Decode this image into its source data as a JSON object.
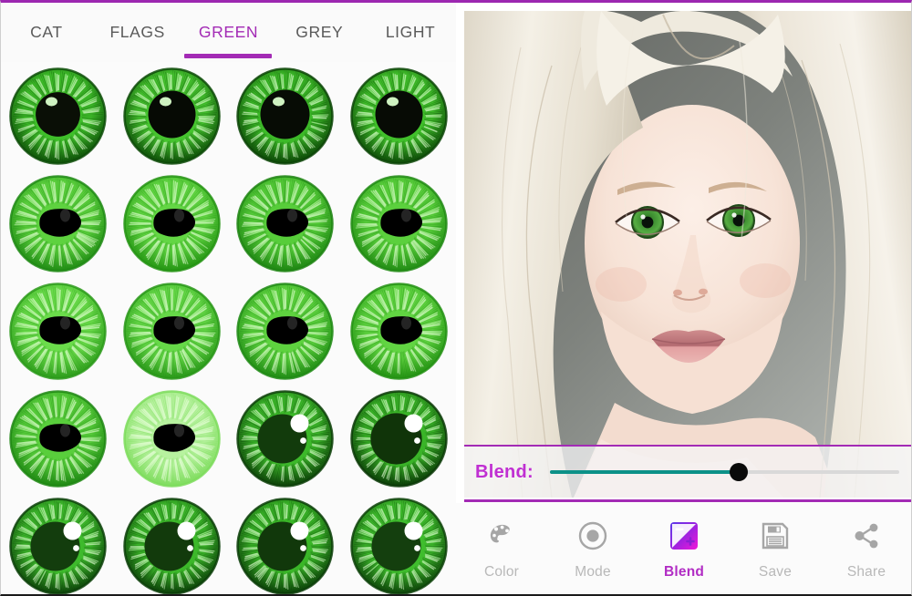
{
  "app": {
    "accent_purple": "#a32bb5",
    "accent_magenta": "#c02fd2",
    "slider_fill_color": "#0c9188",
    "panel_background": "#fafafa"
  },
  "tabs": {
    "active_index": 2,
    "items": [
      {
        "label": "CAT"
      },
      {
        "label": "FLAGS"
      },
      {
        "label": "GREEN"
      },
      {
        "label": "GREY"
      },
      {
        "label": "LIGHT"
      }
    ]
  },
  "thumbnail_grid": {
    "columns": 4,
    "rows_visible": 5,
    "category": "GREEN",
    "items": [
      {
        "name": "green-iris-radial-dark-1",
        "style": "radial-dark",
        "iris": "#3fbf2a",
        "iris_edge": "#0d4d08",
        "pupil": "#0a0f06",
        "pupil_ratio": 0.47,
        "highlight": "top-left-small"
      },
      {
        "name": "green-iris-radial-dark-2",
        "style": "radial-dark",
        "iris": "#46c42f",
        "iris_edge": "#0c4a07",
        "pupil": "#060a04",
        "pupil_ratio": 0.5,
        "highlight": "top-left-small"
      },
      {
        "name": "green-iris-radial-dark-3",
        "style": "radial-dark",
        "iris": "#3cb928",
        "iris_edge": "#0b4406",
        "pupil": "#070c05",
        "pupil_ratio": 0.52,
        "highlight": "top-left-small"
      },
      {
        "name": "green-iris-radial-dark-4",
        "style": "radial-dark",
        "iris": "#41c02b",
        "iris_edge": "#0c4707",
        "pupil": "#070b05",
        "pupil_ratio": 0.5,
        "highlight": "top-left-small"
      },
      {
        "name": "green-iris-cartoon-1",
        "style": "cartoon",
        "iris": "#5ed23f",
        "iris_edge": "#1f8a14",
        "pupil": "#000000",
        "pupil_ratio": 0.4,
        "highlight": "none"
      },
      {
        "name": "green-iris-cartoon-2",
        "style": "cartoon",
        "iris": "#63d644",
        "iris_edge": "#239312",
        "pupil": "#000000",
        "pupil_ratio": 0.38,
        "highlight": "none"
      },
      {
        "name": "green-iris-cartoon-3",
        "style": "cartoon",
        "iris": "#57cd3a",
        "iris_edge": "#1d8412",
        "pupil": "#000000",
        "pupil_ratio": 0.4,
        "highlight": "none"
      },
      {
        "name": "green-iris-cartoon-4",
        "style": "cartoon",
        "iris": "#5bd03d",
        "iris_edge": "#208a13",
        "pupil": "#000000",
        "pupil_ratio": 0.4,
        "highlight": "none"
      },
      {
        "name": "green-iris-cartoon-5",
        "style": "cartoon",
        "iris": "#6bdc4b",
        "iris_edge": "#2b9a1a",
        "pupil": "#000000",
        "pupil_ratio": 0.38,
        "highlight": "none"
      },
      {
        "name": "green-iris-cartoon-6",
        "style": "cartoon",
        "iris": "#66d848",
        "iris_edge": "#289618",
        "pupil": "#000000",
        "pupil_ratio": 0.38,
        "highlight": "none"
      },
      {
        "name": "green-iris-cartoon-7",
        "style": "cartoon",
        "iris": "#5ed23f",
        "iris_edge": "#1f8a14",
        "pupil": "#000000",
        "pupil_ratio": 0.4,
        "highlight": "none"
      },
      {
        "name": "green-iris-cartoon-8",
        "style": "cartoon",
        "iris": "#61d442",
        "iris_edge": "#229012",
        "pupil": "#000000",
        "pupil_ratio": 0.4,
        "highlight": "none"
      },
      {
        "name": "green-iris-cartoon-9",
        "style": "cartoon",
        "iris": "#59ce3c",
        "iris_edge": "#1e8713",
        "pupil": "#000000",
        "pupil_ratio": 0.4,
        "highlight": "none"
      },
      {
        "name": "green-iris-pale-bright",
        "style": "cartoon",
        "iris": "#b7f29f",
        "iris_edge": "#7ddc5c",
        "pupil": "#000000",
        "pupil_ratio": 0.38,
        "highlight": "none"
      },
      {
        "name": "green-iris-glossy-1",
        "style": "glossy",
        "iris": "#3cb82a",
        "iris_edge": "#0c3f08",
        "pupil": "#123b0c",
        "pupil_ratio": 0.52,
        "highlight": "glossy-dot"
      },
      {
        "name": "green-iris-glossy-2",
        "style": "glossy",
        "iris": "#3ab428",
        "iris_edge": "#0a3a07",
        "pupil": "#103409",
        "pupil_ratio": 0.54,
        "highlight": "glossy-dot"
      },
      {
        "name": "green-iris-glossy-3",
        "style": "glossy",
        "iris": "#3eba2c",
        "iris_edge": "#0c4109",
        "pupil": "#133d0d",
        "pupil_ratio": 0.52,
        "highlight": "glossy-dot"
      },
      {
        "name": "green-iris-glossy-4",
        "style": "glossy",
        "iris": "#3cb82a",
        "iris_edge": "#0b3e08",
        "pupil": "#123a0c",
        "pupil_ratio": 0.52,
        "highlight": "glossy-dot"
      },
      {
        "name": "green-iris-glossy-5",
        "style": "glossy",
        "iris": "#3ab628",
        "iris_edge": "#0b3d08",
        "pupil": "#11380b",
        "pupil_ratio": 0.52,
        "highlight": "glossy-dot"
      },
      {
        "name": "green-iris-glossy-6",
        "style": "glossy",
        "iris": "#3fbd2d",
        "iris_edge": "#0d4209",
        "pupil": "#143f0e",
        "pupil_ratio": 0.52,
        "highlight": "glossy-dot"
      }
    ]
  },
  "photo": {
    "alt": "portrait of blonde woman with green eyes",
    "background_color": "#6f726e",
    "hair_color": "#f3efe6",
    "skin_color": "#f6e2d8",
    "eye_color": "#4a9b3e"
  },
  "blend": {
    "label": "Blend:",
    "value_percent": 54,
    "min": 0,
    "max": 100
  },
  "toolbar": {
    "active_index": 2,
    "items": [
      {
        "label": "Color",
        "icon": "palette-icon"
      },
      {
        "label": "Mode",
        "icon": "target-circle-icon"
      },
      {
        "label": "Blend",
        "icon": "blend-gradient-icon"
      },
      {
        "label": "Save",
        "icon": "floppy-disk-icon"
      },
      {
        "label": "Share",
        "icon": "share-nodes-icon"
      }
    ]
  }
}
